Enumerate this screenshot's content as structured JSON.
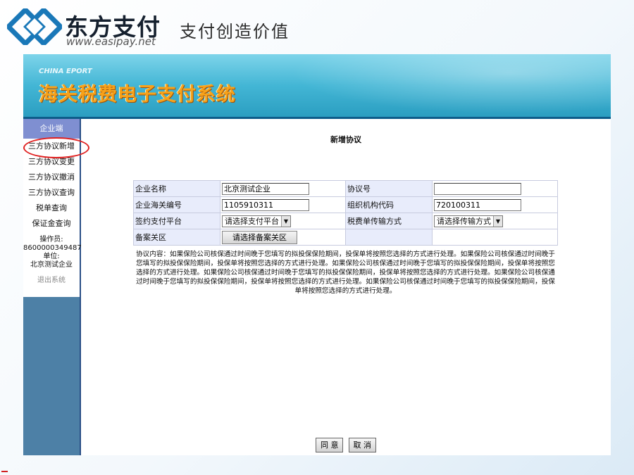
{
  "brand": {
    "name": "东方支付",
    "url": "www.easipay.net",
    "slogan": "支付创造价值"
  },
  "app": {
    "subtitle": "CHINA EPORT",
    "title": "海关税费电子支付系统"
  },
  "sidebar": {
    "header": "企业端",
    "items": [
      {
        "label": "三方协议新增",
        "active": true
      },
      {
        "label": "三方协议变更"
      },
      {
        "label": "三方协议撤消"
      },
      {
        "label": "三方协议查询"
      },
      {
        "label": "税单查询"
      },
      {
        "label": "保证金查询"
      }
    ],
    "operator_label": "操作员:",
    "operator_id": "8600000349487",
    "unit_label": "单位:",
    "unit_name": "北京测试企业",
    "logout": "退出系统"
  },
  "form": {
    "title": "新增协议",
    "enterprise_name_label": "企业名称",
    "enterprise_name_value": "北京测试企业",
    "agreement_no_label": "协议号",
    "agreement_no_value": "",
    "customs_code_label": "企业海关编号",
    "customs_code_value": "1105910311",
    "org_code_label": "组织机构代码",
    "org_code_value": "720100311",
    "platform_label": "签约支付平台",
    "platform_select": "请选择支付平台",
    "transfer_label": "税费单传输方式",
    "transfer_select": "请选择传输方式",
    "region_label": "备案关区",
    "region_button": "请选择备案关区"
  },
  "agreement_text": "协议内容：如果保险公司核保通过时间晚于您填写的拟投保保险期间，投保单将按照您选择的方式进行处理。如果保险公司核保通过时间晚于您填写的拟投保保险期间，投保单将按照您选择的方式进行处理。如果保险公司核保通过时间晚于您填写的拟投保保险期间，投保单将按照您选择的方式进行处理。如果保险公司核保通过时间晚于您填写的拟投保保险期间，投保单将按照您选择的方式进行处理。如果保险公司核保通过时间晚于您填写的拟投保保险期间，投保单将按照您选择的方式进行处理。如果保险公司核保通过时间晚于您填写的拟投保保险期间，投保单将按照您选择的方式进行处理。",
  "actions": {
    "agree": "同 意",
    "cancel": "取 消"
  },
  "colors": {
    "header": "#43b6d5",
    "title_orange": "#f7a21a",
    "sidebar_header": "#7f8fd1",
    "sidebar_fill": "#4d80a6",
    "highlight": "#e02020"
  }
}
